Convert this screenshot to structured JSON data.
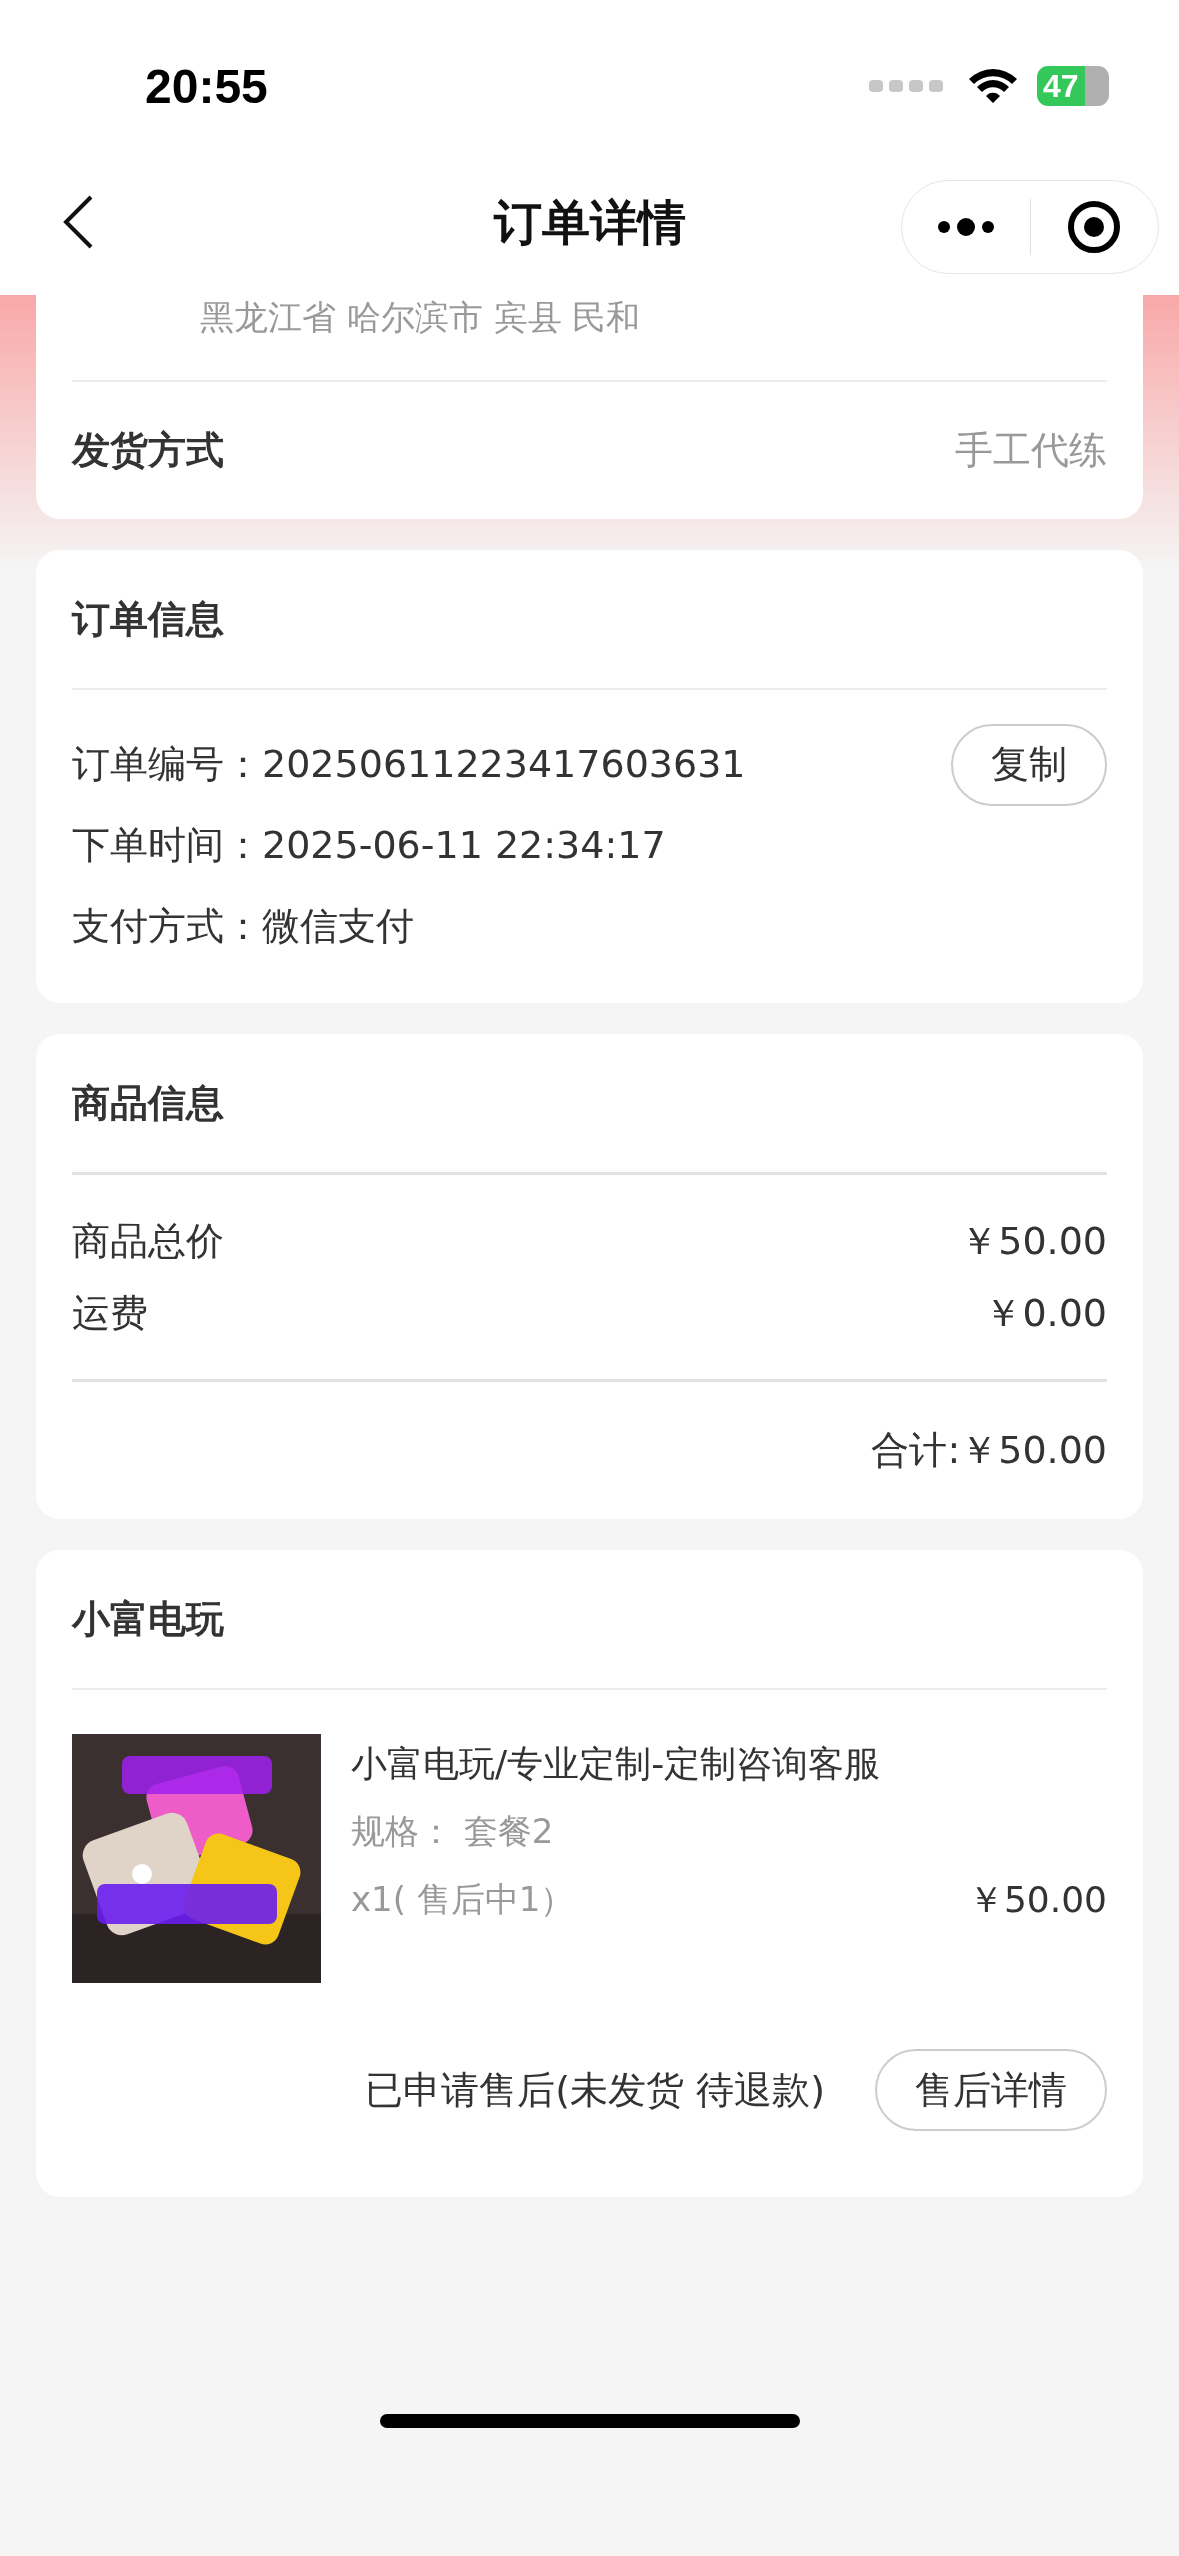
{
  "status_bar": {
    "time": "20:55",
    "battery": "47"
  },
  "nav": {
    "title": "订单详情"
  },
  "delivery_card": {
    "address": "黑龙江省 哈尔滨市 宾县 民和",
    "rows": [
      {
        "label": "发货方式",
        "value": "手工代练"
      }
    ]
  },
  "order_info": {
    "title": "订单信息",
    "fields": [
      {
        "label": "订单编号：",
        "value": "20250611223417603631",
        "action": "复制"
      },
      {
        "label": "下单时间：",
        "value": "2025-06-11 22:34:17"
      },
      {
        "label": "支付方式：",
        "value": "微信支付"
      }
    ]
  },
  "goods_info": {
    "title": "商品信息",
    "rows": [
      {
        "label": "商品总价",
        "value": "￥50.00"
      },
      {
        "label": "运费",
        "value": "￥0.00"
      }
    ],
    "total": "合计:￥50.00"
  },
  "store": {
    "name": "小富电玩",
    "items": [
      {
        "title": "小富电玩/专业定制-定制咨询客服",
        "spec": "规格： 套餐2",
        "quantity": "x1( 售后中1）",
        "price": "￥50.00"
      }
    ],
    "status": "已申请售后(未发货 待退款)",
    "button": "售后详情"
  }
}
